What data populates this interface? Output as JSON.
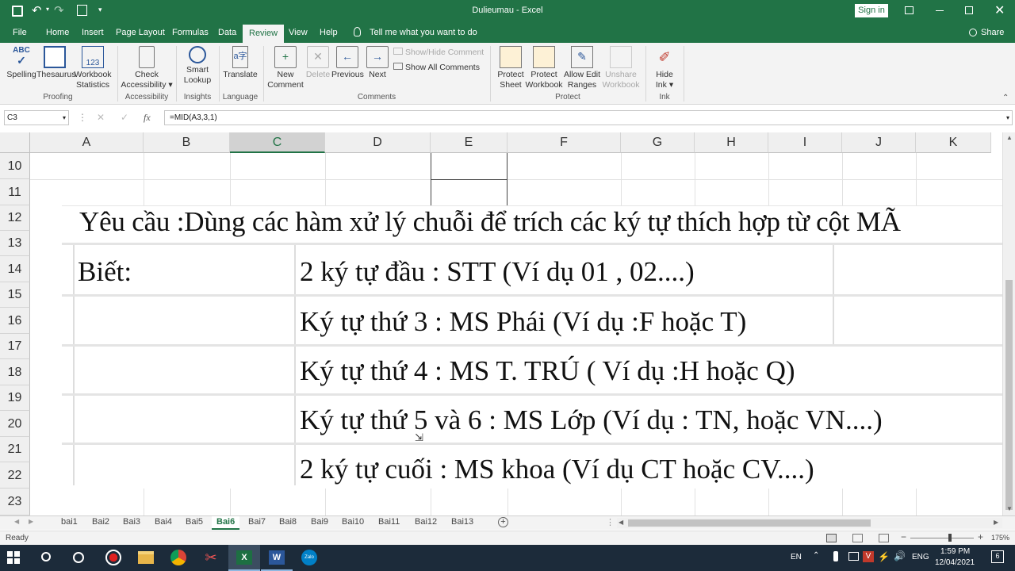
{
  "window": {
    "title": "Dulieumau  -  Excel",
    "signin": "Sign in",
    "share": "Share"
  },
  "tabs": [
    "File",
    "Home",
    "Insert",
    "Page Layout",
    "Formulas",
    "Data",
    "Review",
    "View",
    "Help"
  ],
  "active_tab": "Review",
  "tellme": "Tell me what you want to do",
  "ribbon": {
    "spelling": "Spelling",
    "thesaurus": "Thesaurus",
    "workbook_stats_1": "Workbook",
    "workbook_stats_2": "Statistics",
    "check_acc_1": "Check",
    "check_acc_2": "Accessibility ▾",
    "smart_1": "Smart",
    "smart_2": "Lookup",
    "translate": "Translate",
    "new_comment_1": "New",
    "new_comment_2": "Comment",
    "delete": "Delete",
    "previous": "Previous",
    "next": "Next",
    "show_hide": "Show/Hide Comment",
    "show_all": "Show All Comments",
    "protect_sheet_1": "Protect",
    "protect_sheet_2": "Sheet",
    "protect_wb_1": "Protect",
    "protect_wb_2": "Workbook",
    "allow_edit_1": "Allow Edit",
    "allow_edit_2": "Ranges",
    "unshare_1": "Unshare",
    "unshare_2": "Workbook",
    "hide_ink_1": "Hide",
    "hide_ink_2": "Ink ▾",
    "groups": {
      "proofing": "Proofing",
      "accessibility": "Accessibility",
      "insights": "Insights",
      "language": "Language",
      "comments": "Comments",
      "protect": "Protect",
      "ink": "Ink"
    }
  },
  "formula_bar": {
    "name_box": "C3",
    "fx": "fx",
    "formula": "=MID(A3,3,1)"
  },
  "columns": [
    "A",
    "B",
    "C",
    "D",
    "E",
    "F",
    "G",
    "H",
    "I",
    "J",
    "K"
  ],
  "rows": [
    "10",
    "11",
    "12",
    "13",
    "14",
    "15",
    "16",
    "17",
    "18",
    "19",
    "20",
    "21",
    "22",
    "23"
  ],
  "content": {
    "title_line": "Yêu cầu :Dùng các hàm xử lý chuỗi để trích các ký tự thích hợp từ cột MÃ",
    "biet": "Biết:",
    "line1": "2 ký tự đầu : STT (Ví dụ 01 , 02....)",
    "line2": "Ký tự thứ 3 : MS Phái (Ví dụ :F hoặc T)",
    "line3": "Ký tự thứ 4 : MS T. TRÚ ( Ví dụ :H hoặc Q)",
    "line4": "Ký tự thứ 5 và 6 : MS Lớp (Ví dụ : TN, hoặc VN....)",
    "line5": "2 ký tự cuối : MS khoa (Ví dụ CT hoặc CV....)"
  },
  "sheets": [
    "bai1",
    "Bai2",
    "Bai3",
    "Bai4",
    "Bai5",
    "Bai6",
    "Bai7",
    "Bai8",
    "Bai9",
    "Bai10",
    "Bai11",
    "Bai12",
    "Bai13"
  ],
  "active_sheet": "Bai6",
  "status": {
    "ready": "Ready",
    "zoom": "175%"
  },
  "taskbar": {
    "lang": "EN",
    "ime": "ENG",
    "time": "1:59 PM",
    "date": "12/04/2021",
    "notif": "6"
  },
  "colors": {
    "excel_green": "#217346",
    "active_sheet_text": "#217346"
  }
}
